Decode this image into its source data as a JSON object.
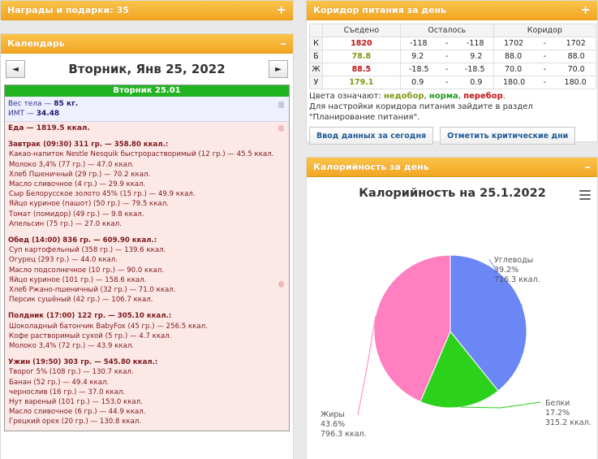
{
  "awards": {
    "title": "Награды и подарки: 35",
    "ctl": "+"
  },
  "calendar": {
    "title": "Календарь",
    "ctl": "–",
    "prev": "◄",
    "next": "►",
    "date_title": "Вторник, Янв 25, 2022",
    "day_head": "Вторник 25.01",
    "weight_label": "Вес тела — ",
    "weight_value": "85 кг.",
    "bmi_label": "ИМТ — ",
    "bmi_value": "34.48",
    "food_total": "Еда — 1819.5 ккал.",
    "meals": [
      {
        "head": "Завтрак (09:30) 311 гр. — 358.80 ккал.:",
        "items": [
          "Какао-напиток Nestle Nesquik быстрорастворимый (12 гр.) — 45.5 ккал.",
          "Молоко 3,4% (77 гр.) — 47.0 ккал.",
          "Хлеб Пшеничный (29 гр.) — 70.2 ккал.",
          "Масло сливочное (4 гр.) — 29.9 ккал.",
          "Сыр Белорусское золото 45% (15 гр.) — 49.9 ккал.",
          "Яйцо куриное (пашот) (50 гр.) — 79.5 ккал.",
          "Томат (помидор) (49 гр.) — 9.8 ккал.",
          "Апельсин (75 гр.) — 27.0 ккал."
        ]
      },
      {
        "head": "Обед (14:00) 836 гр. — 609.90 ккал.:",
        "items": [
          "Суп картофельный (358 гр.) — 139.6 ккал.",
          "Огурец (293 гр.) — 44.0 ккал.",
          "Масло подсолнечное (10 гр.) — 90.0 ккал.",
          "Яйцо куриное (101 гр.) — 158.6 ккал.",
          "Хлеб Ржано-пшеничный (32 гр.) — 71.0 ккал.",
          "Персик сушёный (42 гр.) — 106.7 ккал."
        ]
      },
      {
        "head": "Полдник (17:00) 122 гр. — 305.10 ккал.:",
        "items": [
          "Шоколадный батончик BabyFox (45 гр.) — 256.5 ккал.",
          "Кофе растворимый сухой (5 гр.) — 4.7 ккал.",
          "Молоко 3,4% (72 гр.) — 43.9 ккал."
        ]
      },
      {
        "head": "Ужин (19:50) 303 гр. — 545.80 ккал.:",
        "items": [
          "Творог 5% (108 гр.) — 130.7 ккал.",
          "Банан (52 гр.) — 49.4 ккал.",
          "чернослив (16 гр.) — 37.0 ккал.",
          "Нут вареный (101 гр.) — 153.0 ккал.",
          "Масло сливочное (6 гр.) — 44.9 ккал.",
          "Грецкий орех (20 гр.) — 130.8 ккал."
        ]
      }
    ]
  },
  "corridor": {
    "title": "Коридор питания за день",
    "ctl": "+",
    "headers": [
      "",
      "Съедено",
      "Осталось",
      "Коридор"
    ],
    "rows": [
      {
        "label": "К",
        "eaten": "1820",
        "eaten_color": "#c01212",
        "left_a": "-118",
        "left_b": "-118",
        "corr_a": "1702",
        "corr_b": "1702"
      },
      {
        "label": "Б",
        "eaten": "78.8",
        "eaten_color": "#7a9a10",
        "left_a": "9.2",
        "left_b": "9.2",
        "corr_a": "88.0",
        "corr_b": "88.0"
      },
      {
        "label": "Ж",
        "eaten": "88.5",
        "eaten_color": "#c01212",
        "left_a": "-18.5",
        "left_b": "-18.5",
        "corr_a": "70.0",
        "corr_b": "70.0"
      },
      {
        "label": "У",
        "eaten": "179.1",
        "eaten_color": "#7a9a10",
        "left_a": "0.9",
        "left_b": "0.9",
        "corr_a": "180.0",
        "corr_b": "180.0"
      }
    ],
    "dash": "-",
    "legend_prefix": "Цвета означают: ",
    "legend_under": "недобор",
    "legend_norm": "норма",
    "legend_over": "перебор",
    "hint": "Для настройки коридора питания зайдите в раздел \"Планирование питания\".",
    "btn_today": "Ввод данных за сегодня",
    "btn_critical": "Отметить критические дни"
  },
  "calories": {
    "title": "Калорийность за день",
    "ctl": "–",
    "chart_data": {
      "type": "pie",
      "title": "Калорийность на 25.1.2022",
      "slices": [
        {
          "name": "Углеводы",
          "percent": "39.2%",
          "value": 716.3,
          "value_label": "716.3 ккал.",
          "color": "#6b86f5"
        },
        {
          "name": "Белки",
          "percent": "17.2%",
          "value": 315.2,
          "value_label": "315.2 ккал.",
          "color": "#2bd11b"
        },
        {
          "name": "Жиры",
          "percent": "43.6%",
          "value": 796.3,
          "value_label": "796.3 ккал.",
          "color": "#ff7fc0"
        }
      ]
    }
  }
}
